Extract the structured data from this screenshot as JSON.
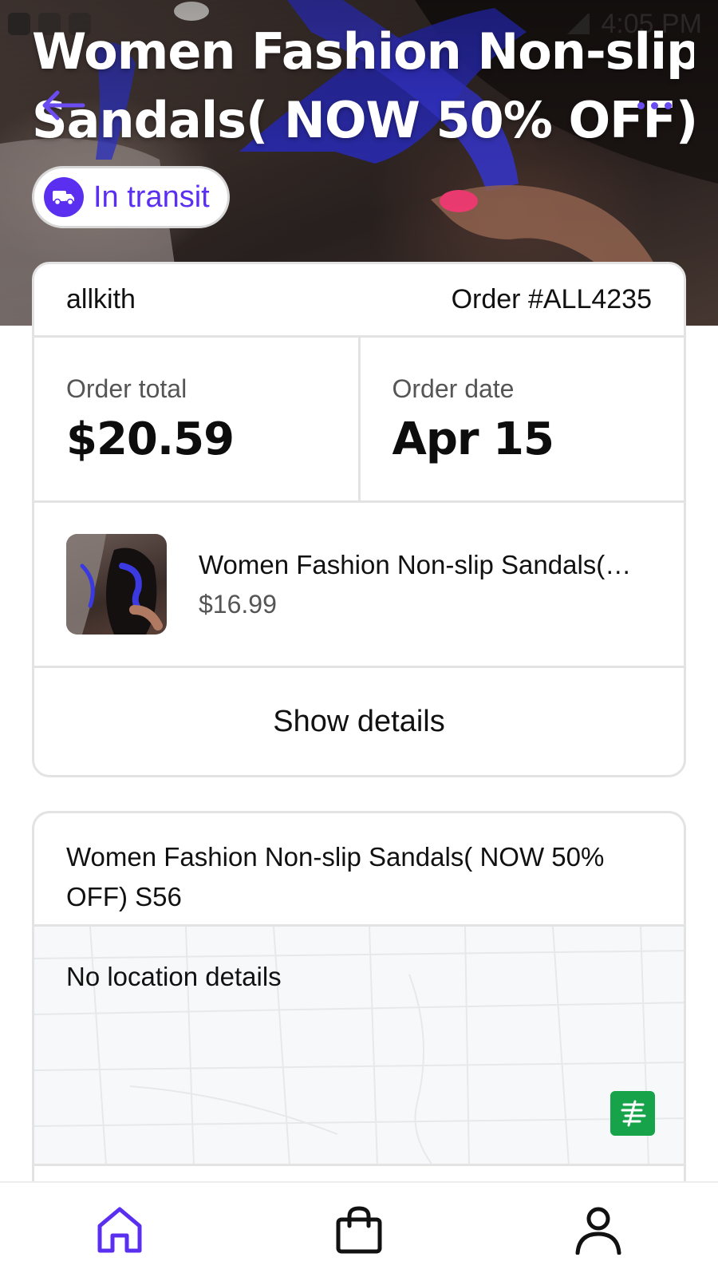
{
  "status_bar": {
    "time": "4:05 PM"
  },
  "header": {
    "title_line1": "Women Fashion Non-slip",
    "title_line2": "Sandals( NOW 50% OFF)..",
    "status_badge": "In transit",
    "back_icon": "arrow-left-icon",
    "more_icon": "more-dots-icon"
  },
  "order": {
    "store": "allkith",
    "order_number": "Order #ALL4235",
    "total_label": "Order total",
    "total_value": "$20.59",
    "date_label": "Order date",
    "date_value": "Apr 15",
    "item": {
      "title": "Women Fashion Non-slip  Sandals(…",
      "price": "$16.99"
    },
    "show_details_label": "Show details"
  },
  "shipment": {
    "title": "Women Fashion Non-slip  Sandals( NOW 50% OFF) S56",
    "location_text": "No location details",
    "carrier_icon": "china-post-logo-icon"
  },
  "bottom_nav": {
    "items": [
      {
        "icon": "home-icon",
        "active": true
      },
      {
        "icon": "shopping-bag-icon",
        "active": false
      },
      {
        "icon": "profile-icon",
        "active": false
      }
    ]
  },
  "colors": {
    "accent": "#5b2ff0",
    "border": "#e3e3e3",
    "carrier_green": "#16a34a"
  }
}
